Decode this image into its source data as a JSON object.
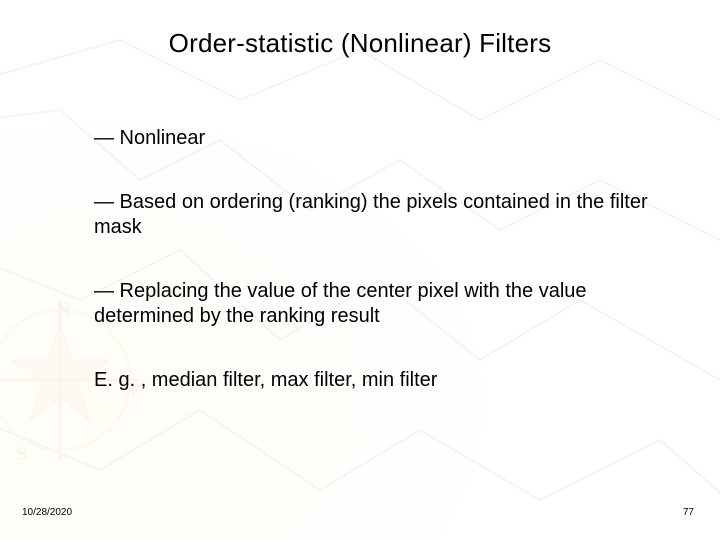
{
  "title": "Order-statistic (Nonlinear) Filters",
  "bullets": [
    "— Nonlinear",
    "— Based on ordering (ranking) the pixels contained in the filter mask",
    "— Replacing the value of the center pixel with the value determined by the ranking result",
    "E. g. , median filter, max filter, min filter"
  ],
  "footer": {
    "date": "10/28/2020",
    "page": "77"
  }
}
